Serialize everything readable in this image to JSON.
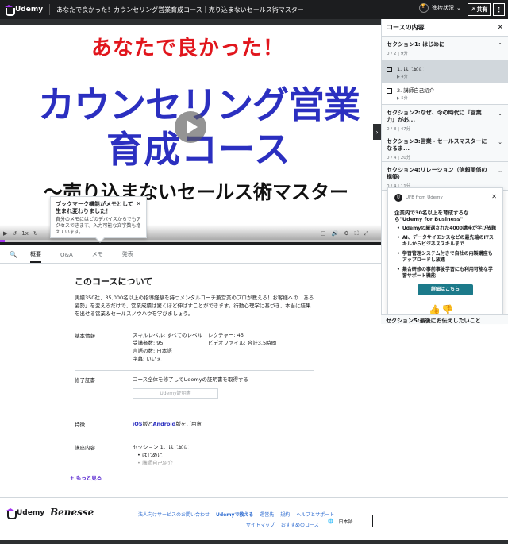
{
  "topbar": {
    "logo": "Udemy",
    "course_title": "あなたで良かった！カウンセリング営業育成コース｜売り込まないセールス術マスター",
    "progress_label": "進捗状況",
    "share_label": "共有",
    "more_label": "⋮"
  },
  "video": {
    "line1": "あなたで良かった！",
    "line2": "カウンセリング営業",
    "line3": "育成コース",
    "line4": "～売り込まないセールス術マスター",
    "speed": "1x",
    "controls_left": [
      "▶",
      "↺",
      "1x",
      "↻"
    ],
    "controls_right": [
      "▢",
      "🔊",
      "⚙",
      "⛶",
      "⤢"
    ]
  },
  "tooltip": {
    "title": "ブックマーク機能がメモとして生まれ変わりました！",
    "body": "自分のメモにはどのデバイスからでもアクセスできます。入力可能な文字数も増えています。",
    "close": "✕"
  },
  "sidebar": {
    "header": "コースの内容",
    "close": "✕",
    "sections": [
      {
        "title": "セクション1: はじめに",
        "meta": "0 / 2 | 9分",
        "chev": "⌃",
        "lectures": [
          {
            "title": "1. はじめに",
            "meta": "▶ 4分"
          },
          {
            "title": "2. 講師自己紹介",
            "meta": "▶ 5分"
          }
        ]
      },
      {
        "title": "セクション2:なぜ、今の時代に『営業力』が必...",
        "meta": "0 / 8 | 47分",
        "chev": "⌄"
      },
      {
        "title": "セクション3:営業・セールスマスターになるま...",
        "meta": "0 / 4 | 20分",
        "chev": "⌄"
      },
      {
        "title": "セクション4:リレーション（信頼関係の構築）",
        "meta": "0 / 4 | 11分",
        "chev": "⌄"
      }
    ],
    "last_section": "セクション5:最後にお伝えしたいこと",
    "handle": "›"
  },
  "promo": {
    "avatar": "U",
    "from": "UFB from Udemy",
    "close": "✕",
    "title": "企業内で30名以上を育成するなら\"Udemy for Business\"",
    "items": [
      "Udemyの厳選された4000講座が学び放題",
      "AI、データサイエンスなどの最先端のITスキルからビジネススキルまで",
      "学習管理システム付きで自社の内製講座もアップロードし放題",
      "集合研修の事前事後学習にも利用可能な学習サポート機能"
    ],
    "button": "詳細はこちら",
    "thumb_up": "👍",
    "thumb_down": "👎"
  },
  "tabs": {
    "search_icon": "🔍",
    "items": [
      "概要",
      "Q&A",
      "メモ",
      "発表"
    ]
  },
  "about": {
    "title": "このコースについて",
    "description": "実績350社、35,000名以上の指導経験を持つメンタルコーチ兼営業のプロが教える！お客様への「ある姿勢」を変えるだけで、営業成績は驚くほど伸ばすことができます。行動心理学に基づき、本当に結果を出せる営業＆セールスノウハウを学びましょう。"
  },
  "info": {
    "label": "基本情報",
    "col1": [
      "スキルレベル: すべてのレベル",
      "受講者数: 95",
      "言語の数: 日本語",
      "字幕: いいえ"
    ],
    "col2": [
      "レクチャー: 45",
      "ビデオファイル: 合計3.5時間"
    ]
  },
  "cert": {
    "label": "修了証書",
    "text": "コース全体を修了してUdemyの証明書を取得する",
    "button": "Udemy証明書"
  },
  "features": {
    "label": "特徴",
    "ios": "iOS",
    "mid": "版と",
    "android": "Android",
    "tail": "版をご用意"
  },
  "curriculum": {
    "label": "講座内容",
    "section": "セクション 1：はじめに",
    "items": [
      "• はじめに",
      "• 講師自己紹介"
    ]
  },
  "more_link": "+ もっと見る",
  "footer": {
    "udemy": "Udemy",
    "benesse": "Benesse",
    "links1": [
      "法人向けサービスのお問い合わせ",
      "Udemyで教える",
      "運営先",
      "規約",
      "ヘルプとサポート"
    ],
    "links2": [
      "サイトマップ",
      "おすすめのコース"
    ],
    "language": "日本語",
    "globe": "🌐"
  },
  "colors": {
    "brand_purple": "#a435f0",
    "title_red": "#e1161d",
    "title_blue": "#2b2fc0",
    "promo_button": "#1c7a8a",
    "topbar": "#1c1d1f"
  }
}
